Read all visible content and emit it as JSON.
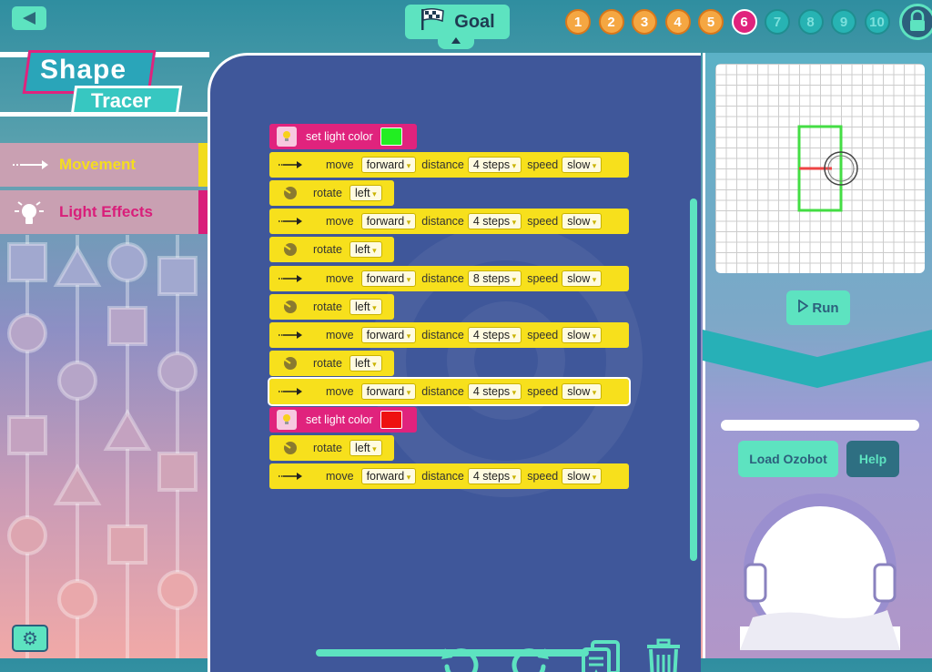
{
  "header": {
    "goal_label": "Goal",
    "levels": [
      "1",
      "2",
      "3",
      "4",
      "5",
      "6",
      "7",
      "8",
      "9",
      "10"
    ],
    "current_level": 6
  },
  "logo": {
    "line1": "Shape",
    "line2": "Tracer"
  },
  "categories": [
    {
      "label": "Movement",
      "color": "#f2dc1c"
    },
    {
      "label": "Light Effects",
      "color": "#d91e7a"
    }
  ],
  "blocks": [
    {
      "type": "light",
      "text": "set light color",
      "color": "#22ee22"
    },
    {
      "type": "move",
      "move": "move",
      "dir": "forward",
      "dist_label": "distance",
      "dist": "4 steps",
      "speed_label": "speed",
      "speed": "slow"
    },
    {
      "type": "rotate",
      "text": "rotate",
      "dir": "left"
    },
    {
      "type": "move",
      "move": "move",
      "dir": "forward",
      "dist_label": "distance",
      "dist": "4 steps",
      "speed_label": "speed",
      "speed": "slow"
    },
    {
      "type": "rotate",
      "text": "rotate",
      "dir": "left"
    },
    {
      "type": "move",
      "move": "move",
      "dir": "forward",
      "dist_label": "distance",
      "dist": "8 steps",
      "speed_label": "speed",
      "speed": "slow"
    },
    {
      "type": "rotate",
      "text": "rotate",
      "dir": "left"
    },
    {
      "type": "move",
      "move": "move",
      "dir": "forward",
      "dist_label": "distance",
      "dist": "4 steps",
      "speed_label": "speed",
      "speed": "slow"
    },
    {
      "type": "rotate",
      "text": "rotate",
      "dir": "left"
    },
    {
      "type": "move",
      "move": "move",
      "dir": "forward",
      "dist_label": "distance",
      "dist": "4 steps",
      "speed_label": "speed",
      "speed": "slow",
      "selected": true
    },
    {
      "type": "light",
      "text": "set light color",
      "color": "#ee1111"
    },
    {
      "type": "rotate",
      "text": "rotate",
      "dir": "left"
    },
    {
      "type": "move",
      "move": "move",
      "dir": "forward",
      "dist_label": "distance",
      "dist": "4 steps",
      "speed_label": "speed",
      "speed": "slow"
    }
  ],
  "toolbar": {
    "icons": [
      "undo-icon",
      "redo-icon",
      "copy-icon",
      "trash-icon"
    ]
  },
  "right_panel": {
    "run_label": "Run",
    "load_label": "Load Ozobot",
    "help_label": "Help"
  },
  "colors": {
    "accent": "#5de3c0",
    "workspace": "#3f579a",
    "move_block": "#f7e01c",
    "light_block": "#e0237d"
  }
}
